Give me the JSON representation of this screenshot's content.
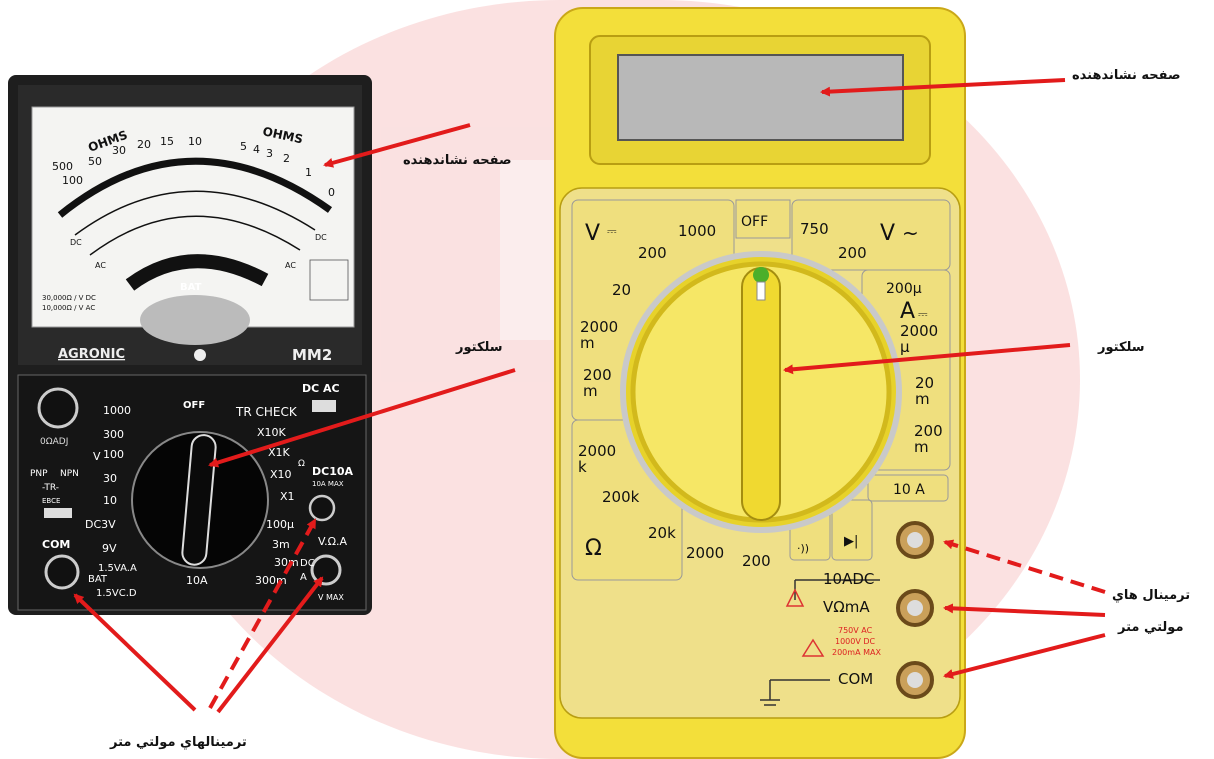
{
  "colors": {
    "watermark": "#f7c9c9",
    "arrow": "#e21b1b",
    "analog_body": "#222222",
    "digital_body": "#f3df3a",
    "digital_panel": "#efe08a",
    "lcd": "#b8b8b8"
  },
  "labels": {
    "display_left": "صفحه نشاندهنده",
    "display_right": "صفحه نشاندهنده",
    "selector_left": "سلكتور",
    "selector_right": "سلكتور",
    "terminals_left": "ترمينالهاي  مولتي متر",
    "terminals_right_line1": "ترمينال هاي",
    "terminals_right_line2": "مولتي متر"
  },
  "analog": {
    "brand": "AGRONIC",
    "model": "MM2",
    "scale_ohms_left": "OHMS",
    "scale_ohms_right": "OHMS",
    "ohm_numbers": [
      "500",
      "100",
      "50",
      "30",
      "20",
      "15",
      "10",
      "5",
      "4",
      "3",
      "2",
      "1",
      "0"
    ],
    "scale_dc": "DC",
    "scale_ac": "AC",
    "bat": "BAT",
    "sens_dc": "30,000Ω / V DC",
    "sens_ac": "10,000Ω / V AC",
    "zero_adj": "0ΩADJ",
    "off": "OFF",
    "tr_check": "TR CHECK",
    "dc_ac": "DC AC",
    "volt_v": "V",
    "ranges_left": [
      "1000",
      "300",
      "100",
      "30",
      "10"
    ],
    "dc3v": "DC3V",
    "v9": "9V",
    "bat_15a": "1.5VA.A",
    "bat_label": "BAT",
    "bat_15c": "1.5VC.D",
    "pnp": "PNP",
    "npn": "NPN",
    "tr": "-TR-",
    "ebc": "EBCE",
    "com": "COM",
    "ranges_right": [
      "X10K",
      "X1K",
      "X10",
      "X1"
    ],
    "omega": "Ω",
    "dc10a": "DC10A",
    "max10a": "10A MAX",
    "current_ranges": [
      "100μ",
      "3m",
      "30m",
      "300m"
    ],
    "a10": "10A",
    "voa": "V.Ω.A",
    "dc_small": "DC",
    "a_small": "A",
    "vmax": "V MAX"
  },
  "digital": {
    "off": "OFF",
    "vdc": "V",
    "vdc_sym": "⎓",
    "vac": "V",
    "vac_sym": "~",
    "vdc_ranges": [
      "1000",
      "200",
      "20",
      "2000\nm",
      "200\nm"
    ],
    "vac_ranges": [
      "750",
      "200"
    ],
    "adc_top": "200μ",
    "adc": "A",
    "adc_sym": "⎓",
    "adc_ranges": [
      "2000\nμ",
      "20\nm",
      "200\nm"
    ],
    "a10": "10 A",
    "ohm_ranges": [
      "2000\nk",
      "200k",
      "20k",
      "2000",
      "200"
    ],
    "omega": "Ω",
    "beep": "·))",
    "diode": "▶|",
    "t_10adc": "10ADC",
    "t_vma": "VΩmA",
    "t_com": "COM",
    "warn1": "750V AC",
    "warn2": "1000V DC",
    "warn3": "200mA MAX"
  }
}
